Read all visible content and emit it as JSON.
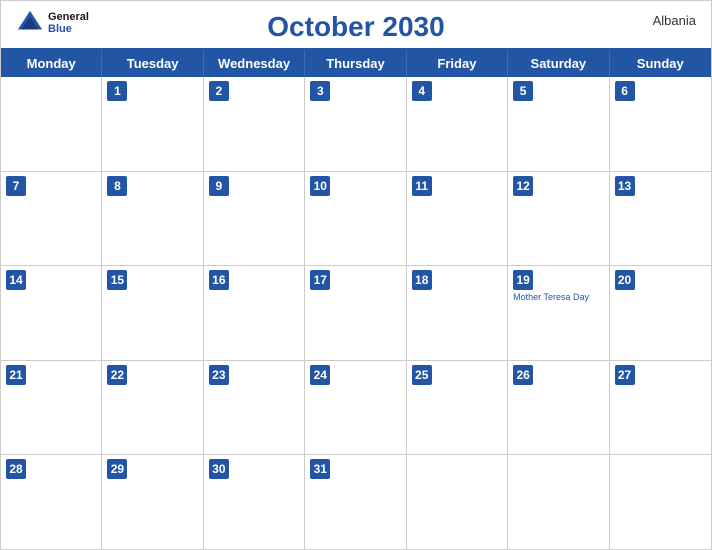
{
  "header": {
    "title": "October 2030",
    "country": "Albania",
    "logo": {
      "general": "General",
      "blue": "Blue"
    }
  },
  "dayHeaders": [
    "Monday",
    "Tuesday",
    "Wednesday",
    "Thursday",
    "Friday",
    "Saturday",
    "Sunday"
  ],
  "weeks": [
    [
      {
        "day": "",
        "empty": true
      },
      {
        "day": "1"
      },
      {
        "day": "2"
      },
      {
        "day": "3"
      },
      {
        "day": "4"
      },
      {
        "day": "5"
      },
      {
        "day": "6"
      }
    ],
    [
      {
        "day": "7"
      },
      {
        "day": "8"
      },
      {
        "day": "9"
      },
      {
        "day": "10"
      },
      {
        "day": "11"
      },
      {
        "day": "12"
      },
      {
        "day": "13"
      }
    ],
    [
      {
        "day": "14"
      },
      {
        "day": "15"
      },
      {
        "day": "16"
      },
      {
        "day": "17"
      },
      {
        "day": "18"
      },
      {
        "day": "19",
        "holiday": "Mother Teresa Day"
      },
      {
        "day": "20"
      }
    ],
    [
      {
        "day": "21"
      },
      {
        "day": "22"
      },
      {
        "day": "23"
      },
      {
        "day": "24"
      },
      {
        "day": "25"
      },
      {
        "day": "26"
      },
      {
        "day": "27"
      }
    ],
    [
      {
        "day": "28"
      },
      {
        "day": "29"
      },
      {
        "day": "30"
      },
      {
        "day": "31"
      },
      {
        "day": "",
        "empty": true
      },
      {
        "day": "",
        "empty": true
      },
      {
        "day": "",
        "empty": true
      }
    ]
  ],
  "colors": {
    "header_bg": "#2255a4",
    "accent": "#2255a4"
  }
}
